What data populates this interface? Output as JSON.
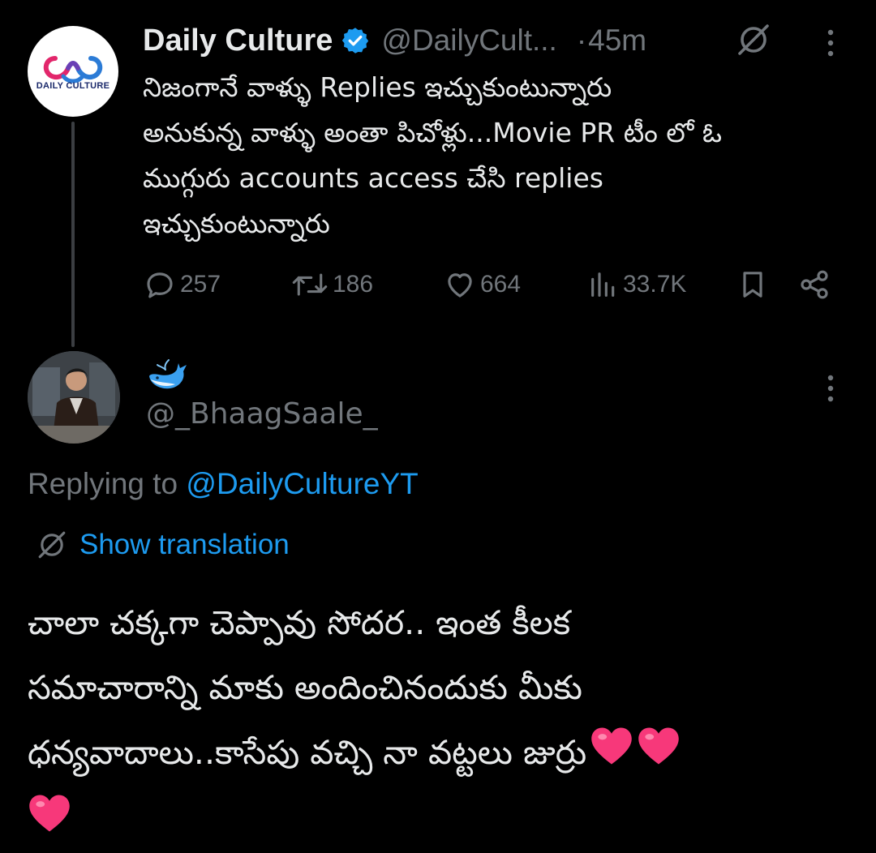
{
  "original_tweet": {
    "author_name": "Daily Culture",
    "avatar_text": "DAILY CULTURE",
    "handle": "@DailyCult...",
    "separator": "·",
    "time": "45m",
    "text_lines": [
      "నిజంగానే వాళ్ళు Replies ఇచ్చుకుంటున్నారు",
      "అనుకున్న వాళ్ళు అంతా పిచోళ్లు...Movie PR టీం లో ఓ",
      "ముగ్గురు accounts access చేసి replies",
      "ఇచ్చుకుంటున్నారు"
    ],
    "stats": {
      "replies": "257",
      "retweets": "186",
      "likes": "664",
      "views": "33.7K"
    },
    "icons": {
      "verified": "verified-badge-icon",
      "grok": "grok-icon",
      "more": "more-vertical-icon",
      "reply": "reply-icon",
      "retweet": "retweet-icon",
      "like": "heart-icon",
      "views": "views-icon",
      "bookmark": "bookmark-icon",
      "share": "share-icon"
    }
  },
  "reply_tweet": {
    "display_name_emoji": "🐳",
    "handle": "@_BhaagSaale_",
    "replying_to_prefix": "Replying to ",
    "replying_to_mention": "@DailyCultureYT",
    "show_translation": "Show translation",
    "text_lines": [
      "చాలా చక్కగా చెప్పావు సోదర.. ఇంత కీలక",
      "సమాచారాన్ని మాకు అందించినందుకు మీకు",
      "ధన్యవాదాలు..కాసేపు వచ్చి నా వట్టలు జుర్రు"
    ],
    "emojis": [
      "heart-emoji",
      "heart-emoji",
      "heart-emoji"
    ]
  },
  "colors": {
    "background": "#000000",
    "text_primary": "#e7e9ea",
    "text_secondary": "#71767b",
    "accent": "#1d9bf0",
    "heart": "#f91880"
  }
}
